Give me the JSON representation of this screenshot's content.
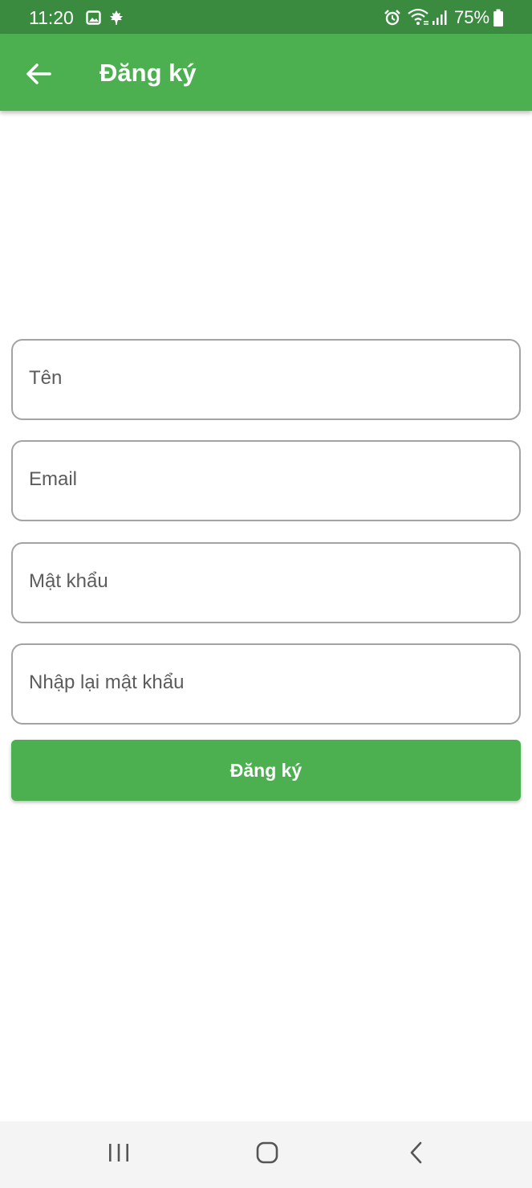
{
  "status_bar": {
    "time": "11:20",
    "battery": "75%",
    "icons": [
      "gallery-icon",
      "maple-leaf-icon",
      "alarm-icon",
      "wifi-icon",
      "signal-icon",
      "battery-icon"
    ],
    "background_color": "#3a8a40"
  },
  "app_bar": {
    "title": "Đăng ký",
    "back_icon": "arrow-left-icon",
    "background_color": "#4caf50"
  },
  "form": {
    "fields": [
      {
        "placeholder": "Tên",
        "value": ""
      },
      {
        "placeholder": "Email",
        "value": ""
      },
      {
        "placeholder": "Mật khẩu",
        "value": ""
      },
      {
        "placeholder": "Nhập lại mật khẩu",
        "value": ""
      }
    ],
    "submit_label": "Đăng ký"
  },
  "nav_bar": {
    "icons": [
      "recents-icon",
      "home-icon",
      "back-icon"
    ]
  }
}
